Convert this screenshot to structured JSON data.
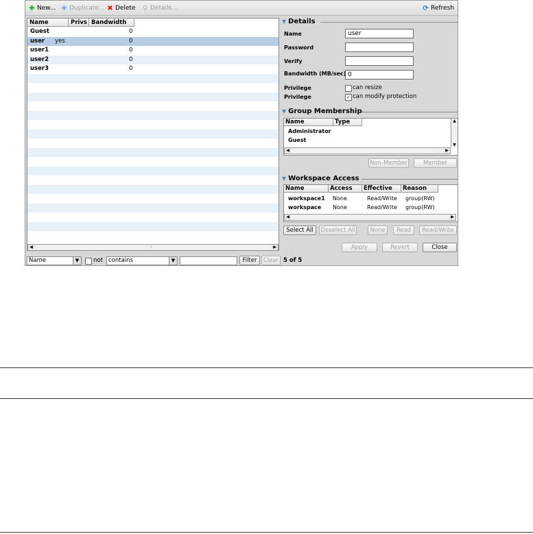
{
  "toolbar": {
    "new": "New...",
    "duplicate": "Duplicate...",
    "delete": "Delete",
    "details": "Details...",
    "refresh": "Refresh"
  },
  "users_table": {
    "columns": [
      "Name",
      "Privs",
      "Bandwidth"
    ],
    "rows": [
      {
        "name": "Guest",
        "privs": "",
        "bandwidth": "0"
      },
      {
        "name": "user",
        "privs": "yes",
        "bandwidth": "0"
      },
      {
        "name": "user1",
        "privs": "",
        "bandwidth": "0"
      },
      {
        "name": "user2",
        "privs": "",
        "bandwidth": "0"
      },
      {
        "name": "user3",
        "privs": "",
        "bandwidth": "0"
      }
    ],
    "selected_index": 1
  },
  "filter": {
    "field": "Name",
    "not_label": "not",
    "operator": "contains",
    "value": "",
    "filter_button": "Filter",
    "clear_button": "Clear",
    "count": "5 of 5"
  },
  "details": {
    "title": "Details",
    "name_label": "Name",
    "name_value": "user",
    "password_label": "Password",
    "verify_label": "Verify",
    "bandwidth_label": "Bandwidth (MB/sec)",
    "bandwidth_value": "0",
    "privilege_label": "Privilege",
    "can_resize": "can resize",
    "can_modify": "can modify protection",
    "can_resize_checked": false,
    "can_modify_checked": true
  },
  "group": {
    "title": "Group Membership",
    "columns": [
      "Name",
      "Type"
    ],
    "rows": [
      "Administrator",
      "Guest"
    ],
    "non_member_button": "Non-Member",
    "member_button": "Member"
  },
  "workspace": {
    "title": "Workspace Access",
    "columns": [
      "Name",
      "Access",
      "Effective",
      "Reason"
    ],
    "rows": [
      {
        "name": "workspace1",
        "access": "None",
        "effective": "Read/Write",
        "reason": "group(RW)"
      },
      {
        "name": "workspace",
        "access": "None",
        "effective": "Read/Write",
        "reason": "group(RW)"
      }
    ],
    "select_all": "Select All",
    "deselect_all": "Deselect All",
    "none": "None",
    "read": "Read",
    "read_write": "Read/Write"
  },
  "actions": {
    "apply": "Apply",
    "revert": "Revert",
    "close": "Close"
  },
  "colors": {
    "selection": "#b6cde4",
    "stripe": "#e8f0f8",
    "accent": "#5a86b8"
  }
}
